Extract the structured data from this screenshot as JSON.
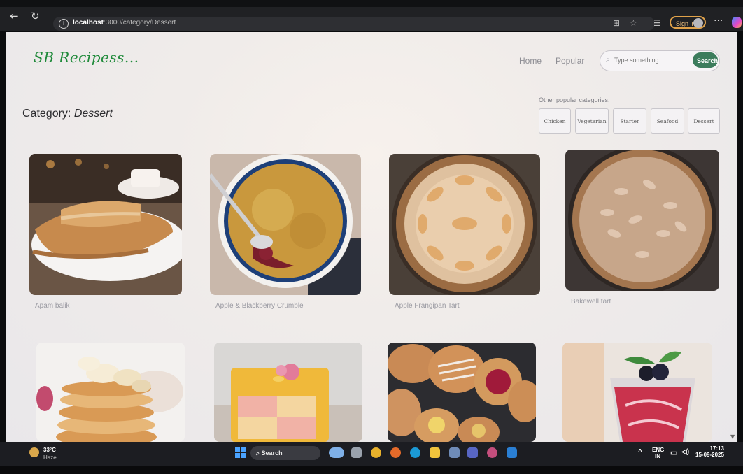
{
  "browser": {
    "url_host": "localhost",
    "url_path": ":3000/category/Dessert",
    "sign_in_label": "Sign in",
    "more_label": "···",
    "back_icon": "arrow-left-icon",
    "reload_icon": "reload-icon"
  },
  "site": {
    "logo": "SB Recipess...",
    "nav": {
      "home": "Home",
      "popular": "Popular"
    },
    "search": {
      "placeholder": "Type something",
      "button": "Search"
    }
  },
  "category": {
    "prefix": "Category: ",
    "name": "Dessert",
    "other_label": "Other popular categories:",
    "chips": [
      "Chicken",
      "Vegetarian",
      "Starter",
      "Seafood",
      "Dessert"
    ]
  },
  "recipes": [
    {
      "name": "Apam balik"
    },
    {
      "name": "Apple & Blackberry Crumble"
    },
    {
      "name": "Apple Frangipan Tart"
    },
    {
      "name": "Bakewell tart"
    },
    {
      "name": ""
    },
    {
      "name": ""
    },
    {
      "name": ""
    },
    {
      "name": ""
    }
  ],
  "taskbar": {
    "weather_temp": "33°C",
    "weather_desc": "Haze",
    "search_label": "Search",
    "lang_top": "ENG",
    "lang_bottom": "IN",
    "time": "17:13",
    "date": "15-09-2025"
  }
}
